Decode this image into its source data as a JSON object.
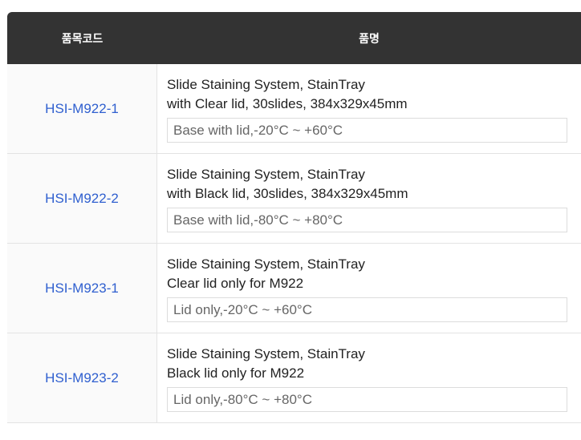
{
  "table": {
    "headers": [
      "품목코드",
      "품명"
    ],
    "rows": [
      {
        "code": "HSI-M922-1",
        "line1": "Slide Staining System, StainTray",
        "line2": "with Clear lid, 30slides, 384x329x45mm",
        "note": "Base with lid,-20°C ~ +60°C"
      },
      {
        "code": "HSI-M922-2",
        "line1": "Slide Staining System, StainTray",
        "line2": "with Black lid, 30slides, 384x329x45mm",
        "note": "Base with lid,-80°C ~ +80°C"
      },
      {
        "code": "HSI-M923-1",
        "line1": "Slide Staining System, StainTray",
        "line2": "Clear lid only for M922",
        "note": "Lid only,-20°C ~ +60°C"
      },
      {
        "code": "HSI-M923-2",
        "line1": "Slide Staining System, StainTray",
        "line2": "Black lid only for M922",
        "note": "Lid only,-80°C ~ +80°C"
      }
    ]
  }
}
